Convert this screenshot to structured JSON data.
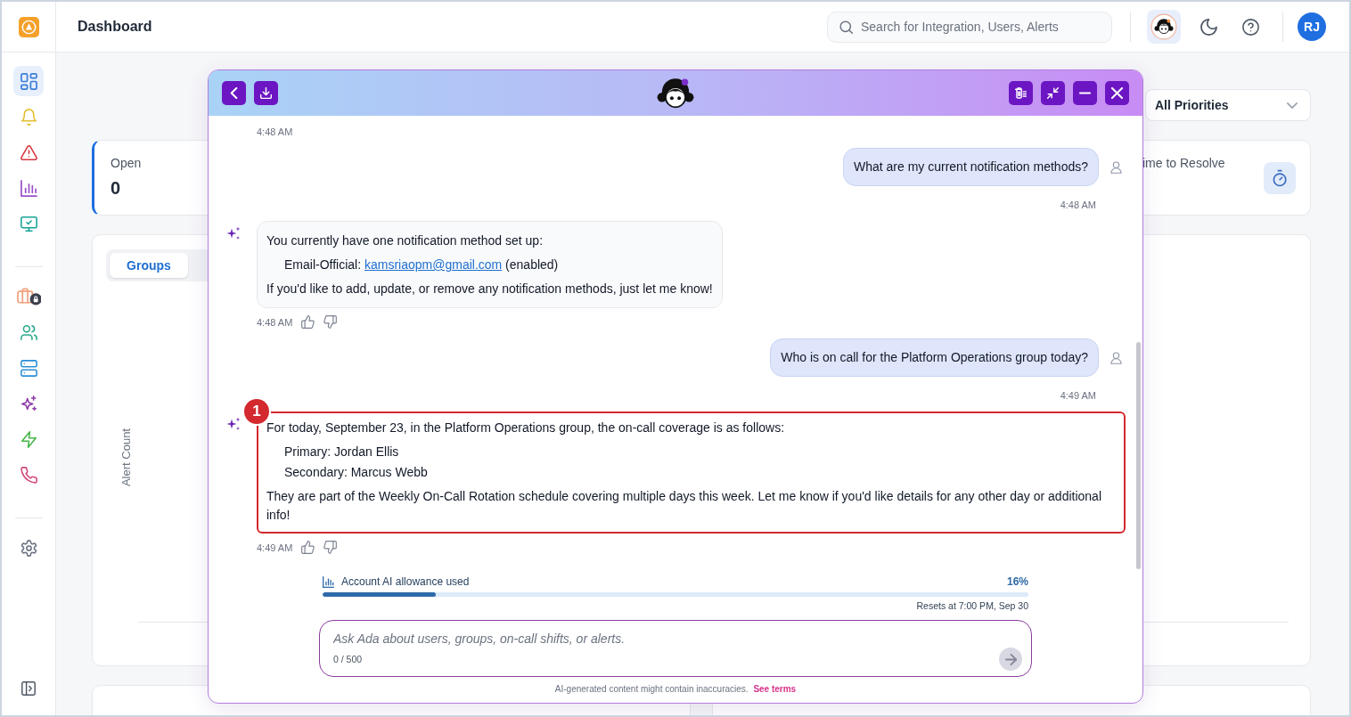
{
  "sidebar": {
    "groups": [
      [
        {
          "selected": true,
          "color": "#3b7dd8"
        },
        {
          "selected": false,
          "color": "#e3bd2f"
        },
        {
          "selected": false,
          "color": "#d9363e"
        },
        {
          "selected": false,
          "color": "#9b51c9"
        },
        {
          "selected": false,
          "color": "#17a398"
        }
      ],
      [
        {
          "selected": false,
          "color": "#f0a27f"
        },
        {
          "selected": false,
          "color": "#2aa98c"
        },
        {
          "selected": false,
          "color": "#2b8fd6"
        },
        {
          "selected": false,
          "color": "#8e3aa8"
        },
        {
          "selected": false,
          "color": "#47b548"
        },
        {
          "selected": false,
          "color": "#d1447c"
        }
      ],
      [
        {
          "selected": false,
          "color": "#6b7280"
        }
      ]
    ]
  },
  "header": {
    "title": "Dashboard",
    "search": {
      "placeholder": "Search for Integration, Users, Alerts"
    },
    "user_initials": "RJ"
  },
  "dashboard": {
    "priority_filter": {
      "value": "All Priorities"
    },
    "stat_cards": [
      {
        "kind": "count",
        "label": "Open",
        "value": "0"
      },
      {
        "kind": "duration",
        "label": "ime to Resolve"
      }
    ],
    "chart_card": {
      "tabs": [
        {
          "label": "Groups",
          "selected": true
        }
      ],
      "y_axis_label": "Alert Count"
    }
  },
  "chat": {
    "messages": [
      {
        "kind": "assistant",
        "time": "4:48 AM",
        "feedback": false
      },
      {
        "kind": "user",
        "text": "What are my current notification methods?",
        "time": "4:48 AM"
      },
      {
        "kind": "assistant",
        "time": "4:48 AM",
        "feedback": true,
        "blocks": [
          {
            "kind": "paragraph",
            "parts": [
              {
                "kind": "text",
                "text": "You currently have one notification method set up:"
              }
            ]
          },
          {
            "kind": "item",
            "parts": [
              {
                "kind": "text",
                "text": "Email-Official: "
              },
              {
                "kind": "link",
                "text": "kamsriaopm@gmail.com"
              },
              {
                "kind": "text",
                "text": " (enabled)"
              }
            ]
          },
          {
            "kind": "paragraph",
            "parts": [
              {
                "kind": "text",
                "text": "If you'd like to add, update, or remove any notification methods, just let me know!"
              }
            ]
          }
        ]
      },
      {
        "kind": "user",
        "text": "Who is on call for the Platform Operations group today?",
        "time": "4:49 AM"
      },
      {
        "kind": "assistant",
        "time": "4:49 AM",
        "feedback": true,
        "callout": "1",
        "blocks": [
          {
            "kind": "paragraph",
            "parts": [
              {
                "kind": "text",
                "text": "For today, September 23, in the Platform Operations group, the on-call coverage is as follows:"
              }
            ]
          },
          {
            "kind": "item",
            "parts": [
              {
                "kind": "text",
                "text": "Primary: Jordan Ellis"
              }
            ]
          },
          {
            "kind": "item",
            "parts": [
              {
                "kind": "text",
                "text": "Secondary: Marcus Webb"
              }
            ]
          },
          {
            "kind": "paragraph",
            "parts": [
              {
                "kind": "text",
                "text": "They are part of the Weekly On-Call Rotation schedule covering multiple days this week. Let me know if you'd like details for any other day or additional info!"
              }
            ]
          }
        ]
      }
    ],
    "usage": {
      "label": "Account AI allowance used",
      "percent": "16%",
      "level": 0.16,
      "reset_note": "Resets at 7:00 PM, Sep 30"
    },
    "input": {
      "placeholder": "Ask Ada about users, groups, on-call shifts, or alerts.",
      "counter": "0 / 500"
    },
    "disclaimer": {
      "text": "AI-generated content might contain inaccuracies.",
      "link": "See terms"
    }
  }
}
